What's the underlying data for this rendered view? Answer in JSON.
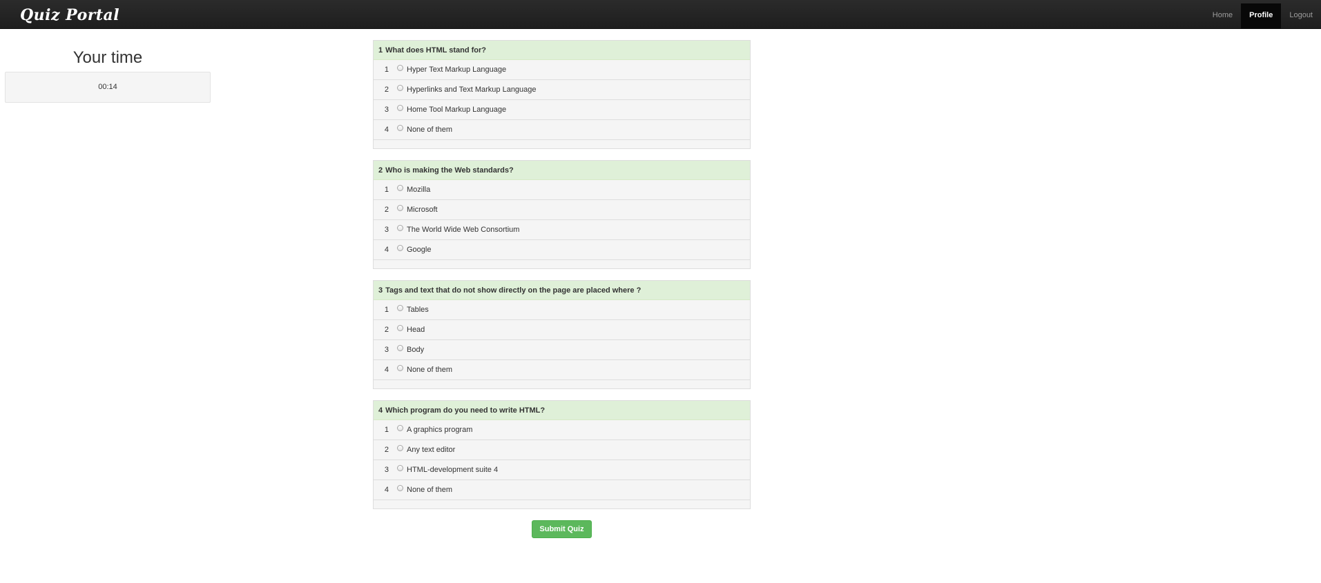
{
  "navbar": {
    "brand": "Quiz Portal",
    "links": [
      {
        "label": "Home",
        "active": false
      },
      {
        "label": "Profile",
        "active": true
      },
      {
        "label": "Logout",
        "active": false
      }
    ]
  },
  "timer": {
    "title": "Your time",
    "value": "00:14"
  },
  "questions": [
    {
      "number": "1",
      "text": "What does HTML stand for?",
      "options": [
        {
          "index": "1",
          "label": "Hyper Text Markup Language"
        },
        {
          "index": "2",
          "label": "Hyperlinks and Text Markup Language"
        },
        {
          "index": "3",
          "label": "Home Tool Markup Language"
        },
        {
          "index": "4",
          "label": "None of them"
        }
      ]
    },
    {
      "number": "2",
      "text": "Who is making the Web standards?",
      "options": [
        {
          "index": "1",
          "label": "Mozilla"
        },
        {
          "index": "2",
          "label": "Microsoft"
        },
        {
          "index": "3",
          "label": "The World Wide Web Consortium"
        },
        {
          "index": "4",
          "label": "Google"
        }
      ]
    },
    {
      "number": "3",
      "text": "Tags and text that do not show directly on the page are placed where ?",
      "options": [
        {
          "index": "1",
          "label": "Tables"
        },
        {
          "index": "2",
          "label": "Head"
        },
        {
          "index": "3",
          "label": "Body"
        },
        {
          "index": "4",
          "label": "None of them"
        }
      ]
    },
    {
      "number": "4",
      "text": "Which program do you need to write HTML?",
      "options": [
        {
          "index": "1",
          "label": "A graphics program"
        },
        {
          "index": "2",
          "label": "Any text editor"
        },
        {
          "index": "3",
          "label": "HTML-development suite 4"
        },
        {
          "index": "4",
          "label": "None of them"
        }
      ]
    }
  ],
  "submit_label": "Submit Quiz"
}
